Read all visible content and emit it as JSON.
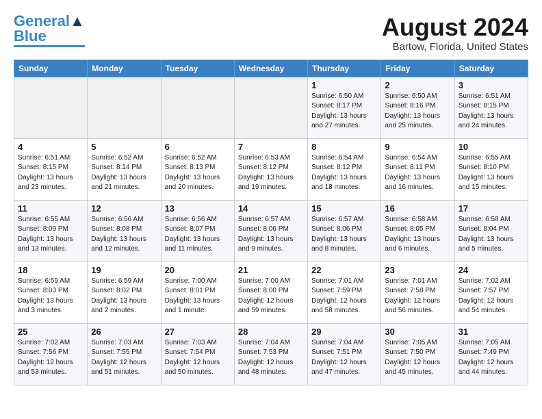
{
  "header": {
    "logo_line1": "General",
    "logo_line2": "Blue",
    "month_year": "August 2024",
    "location": "Bartow, Florida, United States"
  },
  "weekdays": [
    "Sunday",
    "Monday",
    "Tuesday",
    "Wednesday",
    "Thursday",
    "Friday",
    "Saturday"
  ],
  "weeks": [
    [
      {
        "day": "",
        "info": ""
      },
      {
        "day": "",
        "info": ""
      },
      {
        "day": "",
        "info": ""
      },
      {
        "day": "",
        "info": ""
      },
      {
        "day": "1",
        "info": "Sunrise: 6:50 AM\nSunset: 8:17 PM\nDaylight: 13 hours\nand 27 minutes."
      },
      {
        "day": "2",
        "info": "Sunrise: 6:50 AM\nSunset: 8:16 PM\nDaylight: 13 hours\nand 25 minutes."
      },
      {
        "day": "3",
        "info": "Sunrise: 6:51 AM\nSunset: 8:15 PM\nDaylight: 13 hours\nand 24 minutes."
      }
    ],
    [
      {
        "day": "4",
        "info": "Sunrise: 6:51 AM\nSunset: 8:15 PM\nDaylight: 13 hours\nand 23 minutes."
      },
      {
        "day": "5",
        "info": "Sunrise: 6:52 AM\nSunset: 8:14 PM\nDaylight: 13 hours\nand 21 minutes."
      },
      {
        "day": "6",
        "info": "Sunrise: 6:52 AM\nSunset: 8:13 PM\nDaylight: 13 hours\nand 20 minutes."
      },
      {
        "day": "7",
        "info": "Sunrise: 6:53 AM\nSunset: 8:12 PM\nDaylight: 13 hours\nand 19 minutes."
      },
      {
        "day": "8",
        "info": "Sunrise: 6:54 AM\nSunset: 8:12 PM\nDaylight: 13 hours\nand 18 minutes."
      },
      {
        "day": "9",
        "info": "Sunrise: 6:54 AM\nSunset: 8:11 PM\nDaylight: 13 hours\nand 16 minutes."
      },
      {
        "day": "10",
        "info": "Sunrise: 6:55 AM\nSunset: 8:10 PM\nDaylight: 13 hours\nand 15 minutes."
      }
    ],
    [
      {
        "day": "11",
        "info": "Sunrise: 6:55 AM\nSunset: 8:09 PM\nDaylight: 13 hours\nand 13 minutes."
      },
      {
        "day": "12",
        "info": "Sunrise: 6:56 AM\nSunset: 8:08 PM\nDaylight: 13 hours\nand 12 minutes."
      },
      {
        "day": "13",
        "info": "Sunrise: 6:56 AM\nSunset: 8:07 PM\nDaylight: 13 hours\nand 11 minutes."
      },
      {
        "day": "14",
        "info": "Sunrise: 6:57 AM\nSunset: 8:06 PM\nDaylight: 13 hours\nand 9 minutes."
      },
      {
        "day": "15",
        "info": "Sunrise: 6:57 AM\nSunset: 8:06 PM\nDaylight: 13 hours\nand 8 minutes."
      },
      {
        "day": "16",
        "info": "Sunrise: 6:58 AM\nSunset: 8:05 PM\nDaylight: 13 hours\nand 6 minutes."
      },
      {
        "day": "17",
        "info": "Sunrise: 6:58 AM\nSunset: 8:04 PM\nDaylight: 13 hours\nand 5 minutes."
      }
    ],
    [
      {
        "day": "18",
        "info": "Sunrise: 6:59 AM\nSunset: 8:03 PM\nDaylight: 13 hours\nand 3 minutes."
      },
      {
        "day": "19",
        "info": "Sunrise: 6:59 AM\nSunset: 8:02 PM\nDaylight: 13 hours\nand 2 minutes."
      },
      {
        "day": "20",
        "info": "Sunrise: 7:00 AM\nSunset: 8:01 PM\nDaylight: 13 hours\nand 1 minute."
      },
      {
        "day": "21",
        "info": "Sunrise: 7:00 AM\nSunset: 8:00 PM\nDaylight: 12 hours\nand 59 minutes."
      },
      {
        "day": "22",
        "info": "Sunrise: 7:01 AM\nSunset: 7:59 PM\nDaylight: 12 hours\nand 58 minutes."
      },
      {
        "day": "23",
        "info": "Sunrise: 7:01 AM\nSunset: 7:58 PM\nDaylight: 12 hours\nand 56 minutes."
      },
      {
        "day": "24",
        "info": "Sunrise: 7:02 AM\nSunset: 7:57 PM\nDaylight: 12 hours\nand 54 minutes."
      }
    ],
    [
      {
        "day": "25",
        "info": "Sunrise: 7:02 AM\nSunset: 7:56 PM\nDaylight: 12 hours\nand 53 minutes."
      },
      {
        "day": "26",
        "info": "Sunrise: 7:03 AM\nSunset: 7:55 PM\nDaylight: 12 hours\nand 51 minutes."
      },
      {
        "day": "27",
        "info": "Sunrise: 7:03 AM\nSunset: 7:54 PM\nDaylight: 12 hours\nand 50 minutes."
      },
      {
        "day": "28",
        "info": "Sunrise: 7:04 AM\nSunset: 7:53 PM\nDaylight: 12 hours\nand 48 minutes."
      },
      {
        "day": "29",
        "info": "Sunrise: 7:04 AM\nSunset: 7:51 PM\nDaylight: 12 hours\nand 47 minutes."
      },
      {
        "day": "30",
        "info": "Sunrise: 7:05 AM\nSunset: 7:50 PM\nDaylight: 12 hours\nand 45 minutes."
      },
      {
        "day": "31",
        "info": "Sunrise: 7:05 AM\nSunset: 7:49 PM\nDaylight: 12 hours\nand 44 minutes."
      }
    ]
  ]
}
